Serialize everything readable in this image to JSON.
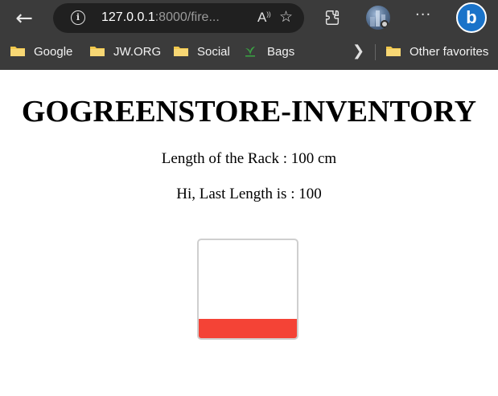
{
  "browser": {
    "url_host": "127.0.0.1",
    "url_rest": ":8000/fire...",
    "bookmarks": [
      {
        "label": "Google",
        "icon": "folder-icon"
      },
      {
        "label": "JW.ORG",
        "icon": "folder-icon"
      },
      {
        "label": "Social",
        "icon": "folder-icon"
      },
      {
        "label": "Bags",
        "icon": "leaf-favicon"
      },
      {
        "label": "Other favorites",
        "icon": "folder-icon"
      }
    ],
    "colors": {
      "chrome": "#3b3b3b",
      "address_bar": "#202020",
      "folder": "#f2c84b",
      "bing": "#1a73c9"
    }
  },
  "page": {
    "title": "GOGREENSTORE-INVENTORY",
    "rack_length_text": "Length of the Rack : 100 cm",
    "last_length_text": "Hi, Last Length is : 100",
    "rack": {
      "fill_fraction": 0.2,
      "fill_color": "#f44336",
      "border_color": "#cfcfcf"
    }
  }
}
